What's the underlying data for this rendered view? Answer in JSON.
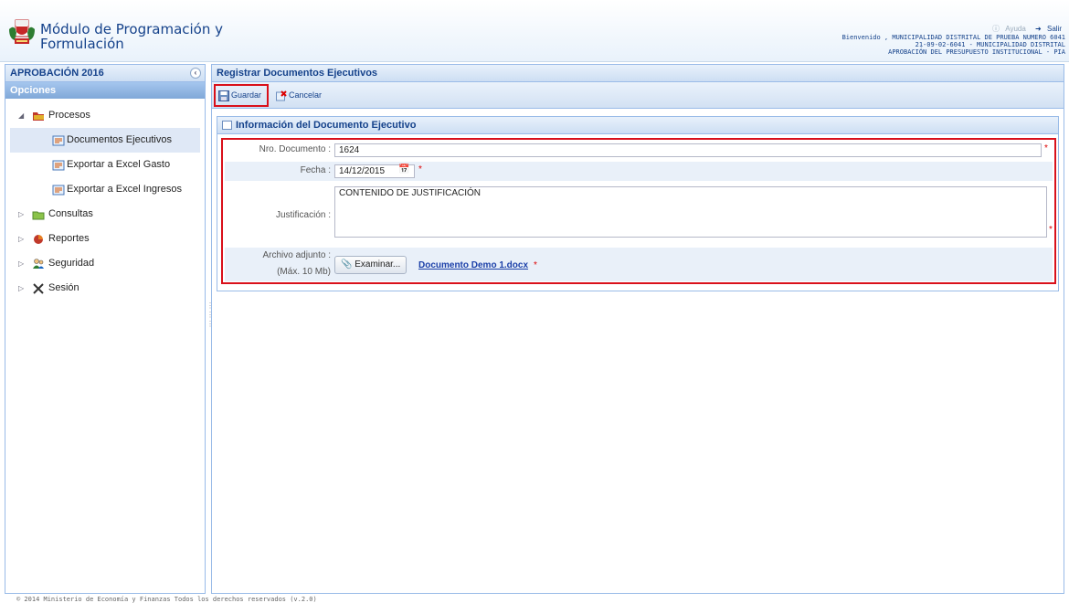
{
  "header": {
    "app_title_line1": "Módulo de Programación y",
    "app_title_line2": "Formulación",
    "help_label": "Ayuda",
    "exit_label": "Salir",
    "welcome_line1": "Bienvenido , MUNICIPALIDAD DISTRITAL DE PRUEBA NUMERO 6041",
    "welcome_line2": "21-09-02-6041 - MUNICIPALIDAD DISTRITAL",
    "welcome_line3": "APROBACIÓN DEL PRESUPUESTO INSTITUCIONAL - PIA"
  },
  "sidebar": {
    "title": "APROBACIÓN 2016",
    "options_label": "Opciones",
    "items": [
      {
        "label": "Procesos",
        "icon": "folder-icon"
      },
      {
        "label": "Documentos Ejecutivos",
        "icon": "document-icon"
      },
      {
        "label": "Exportar a Excel Gasto",
        "icon": "document-icon"
      },
      {
        "label": "Exportar a Excel Ingresos",
        "icon": "document-icon"
      },
      {
        "label": "Consultas",
        "icon": "folder-icon"
      },
      {
        "label": "Reportes",
        "icon": "chart-icon"
      },
      {
        "label": "Seguridad",
        "icon": "users-icon"
      },
      {
        "label": "Sesión",
        "icon": "tools-icon"
      }
    ]
  },
  "main": {
    "title": "Registrar Documentos Ejecutivos",
    "toolbar": {
      "save_label": "Guardar",
      "cancel_label": "Cancelar"
    },
    "section_title": "Información del Documento Ejecutivo",
    "form": {
      "nro_label": "Nro. Documento :",
      "nro_value": "1624",
      "fecha_label": "Fecha :",
      "fecha_value": "14/12/2015",
      "justificacion_label": "Justificación :",
      "justificacion_value": "CONTENIDO DE JUSTIFICACIÓN",
      "archivo_label": "Archivo adjunto :",
      "archivo_max": "(Máx. 10 Mb)",
      "browse_label": "Examinar...",
      "file_name": "Documento Demo 1.docx",
      "required_mark": "*"
    }
  },
  "footer": {
    "text": "© 2014 Ministerio de Economía y Finanzas Todos los derechos reservados (v.2.0)"
  },
  "colors": {
    "accent": "#15428b",
    "highlight": "#d9101a",
    "panel_border": "#99bbe8"
  }
}
